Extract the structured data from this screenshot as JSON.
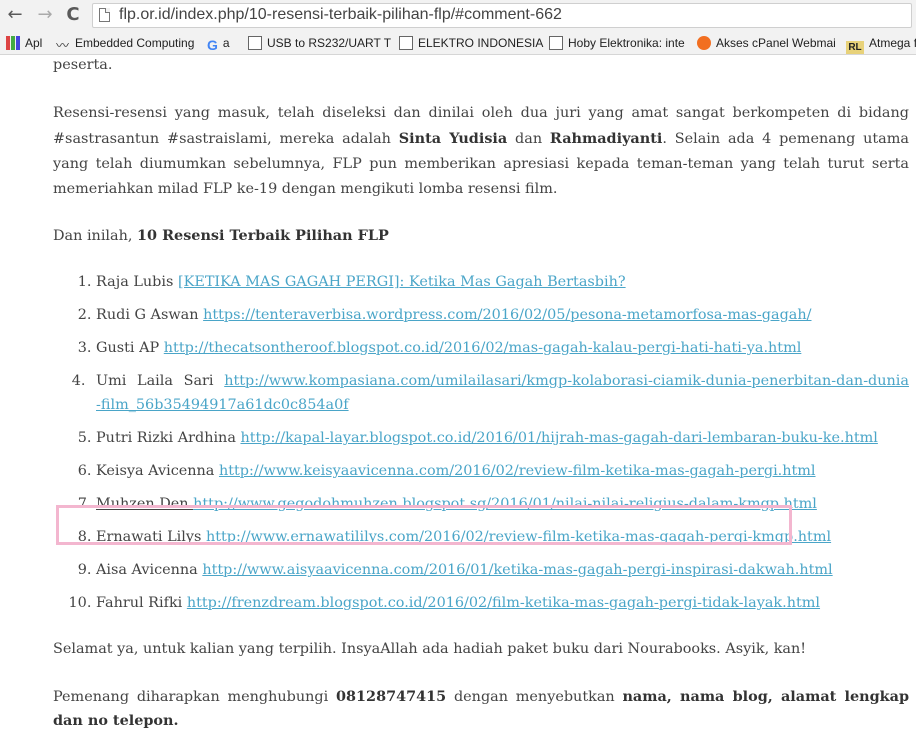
{
  "browser": {
    "url": "flp.or.id/index.php/10-resensi-terbaik-pilihan-flp/#comment-662",
    "nav": {
      "back": "←",
      "forward": "→",
      "reload": "C"
    },
    "bookmarks": [
      {
        "label": "Apl",
        "icon": "apps-grid-icon"
      },
      {
        "label": "Embedded Computing",
        "icon": "wave-icon"
      },
      {
        "label": "a",
        "icon": "google-icon",
        "glyph": "G"
      },
      {
        "label": "USB to RS232/UART T",
        "icon": "page-icon"
      },
      {
        "label": "ELEKTRO INDONESIA",
        "icon": "page-icon"
      },
      {
        "label": "Hoby Elektronika: inte",
        "icon": "page-icon"
      },
      {
        "label": "Akses cPanel Webmai",
        "icon": "cpanel-icon"
      },
      {
        "label": "Atmega f",
        "icon": "rl-icon",
        "glyph": "RL"
      }
    ]
  },
  "article": {
    "top_text": "peserta.",
    "para1": {
      "t1": "Resensi-resensi yang masuk, telah diseleksi dan dinilai oleh dua juri yang amat sangat berkompeten di bidang #sastrasantun #sastraislami, mereka adalah ",
      "judge1": "Sinta Yudisia",
      "t2": " dan ",
      "judge2": "Rahmadiyanti",
      "t3": ". Selain ada 4 pemenang utama yang telah diumumkan sebelumnya, FLP pun memberikan apresiasi kepada teman-teman yang telah turut serta memeriahkan milad FLP ke-19 dengan mengikuti lomba resensi film."
    },
    "intro": {
      "t1": "Dan inilah, ",
      "bold": "10 Resensi Terbaik Pilihan FLP"
    },
    "entries": [
      {
        "name": "Raja Lubis ",
        "link": "[KETIKA MAS GAGAH PERGI]: Ketika Mas Gagah Bertasbih?"
      },
      {
        "name": "Rudi G Aswan ",
        "link": "https://tenteraverbisa.wordpress.com/2016/02/05/pesona-metamorfosa-mas-gagah/"
      },
      {
        "name": "Gusti AP ",
        "link": "http://thecatsontheroof.blogspot.co.id/2016/02/mas-gagah-kalau-pergi-hati-hati-ya.html"
      },
      {
        "name": "Umi Laila Sari ",
        "link": "http://www.kompasiana.com/umilailasari/kmgp-kolaborasi-ciamik-dunia-penerbitan-dan-dunia-film_56b35494917a61dc0c854a0f"
      },
      {
        "name": "Putri Rizki Ardhina ",
        "link": "http://kapal-layar.blogspot.co.id/2016/01/hijrah-mas-gagah-dari-lembaran-buku-ke.html"
      },
      {
        "name": "Keisya Avicenna ",
        "link": "http://www.keisyaavicenna.com/2016/02/review-film-ketika-mas-gagah-pergi.html"
      },
      {
        "name": "Muhzen Den ",
        "link": "http://www.gegodohmuhzen.blogspot.sg/2016/01/nilai-nilai-religius-dalam-kmgp.html"
      },
      {
        "name": "Ernawati Lilys ",
        "link": "http://www.ernawatililys.com/2016/02/review-film-ketika-mas-gagah-pergi-kmgp.html"
      },
      {
        "name": "Aisa Avicenna ",
        "link": "http://www.aisyaavicenna.com/2016/01/ketika-mas-gagah-pergi-inspirasi-dakwah.html"
      },
      {
        "name": "Fahrul Rifki ",
        "link": "http://frenzdream.blogspot.co.id/2016/02/film-ketika-mas-gagah-pergi-tidak-layak.html"
      }
    ],
    "closing": "Selamat ya, untuk kalian yang terpilih. InsyaAllah ada hadiah paket buku dari Nourabooks. Asyik, kan!",
    "contact": {
      "t1": "Pemenang diharapkan menghubungi ",
      "phone": "08128747415",
      "t2": " dengan menyebutkan ",
      "bold2": "nama, nama blog, alamat lengkap dan no telepon."
    }
  }
}
